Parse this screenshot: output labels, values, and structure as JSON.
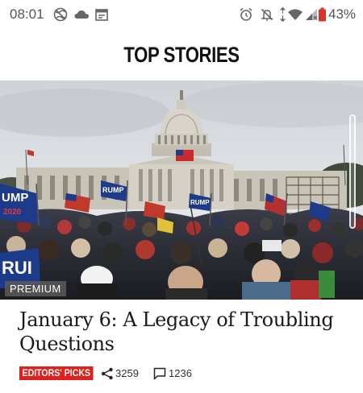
{
  "status_bar": {
    "time": "08:01",
    "left_icons": [
      "globe-icon",
      "cloud-icon",
      "calendar-icon"
    ],
    "right_icons": [
      "alarm-icon",
      "mute-icon",
      "data-arrows-icon",
      "wifi-icon",
      "signal-icon",
      "battery-icon"
    ],
    "battery_percent": "43%",
    "battery_color": "#d9342b"
  },
  "header": {
    "title": "TOP STORIES"
  },
  "article": {
    "premium_label": "PREMIUM",
    "headline": "January 6: A Legacy of Troubling Questions",
    "tag": "EDITORS' PICKS",
    "share_count": "3259",
    "comment_count": "1236",
    "tag_color": "#e0201d"
  }
}
